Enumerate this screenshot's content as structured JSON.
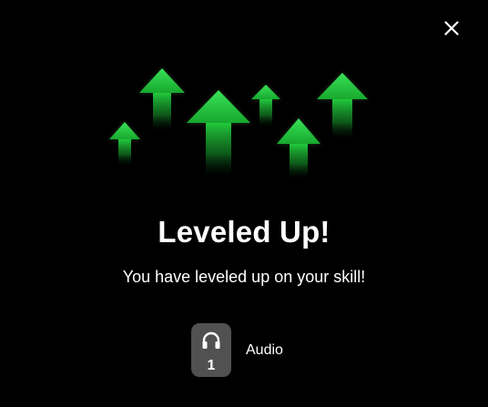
{
  "dialog": {
    "title": "Leveled Up!",
    "message": "You have leveled up on your skill!",
    "close_icon": "close-icon",
    "illustration": "level-up-arrows-icon"
  },
  "skill": {
    "name": "Audio",
    "level": "1",
    "icon": "headphones-icon"
  },
  "colors": {
    "background": "#000000",
    "text": "#ffffff",
    "arrow_green": "#1fbf3a",
    "badge": "#515151"
  }
}
